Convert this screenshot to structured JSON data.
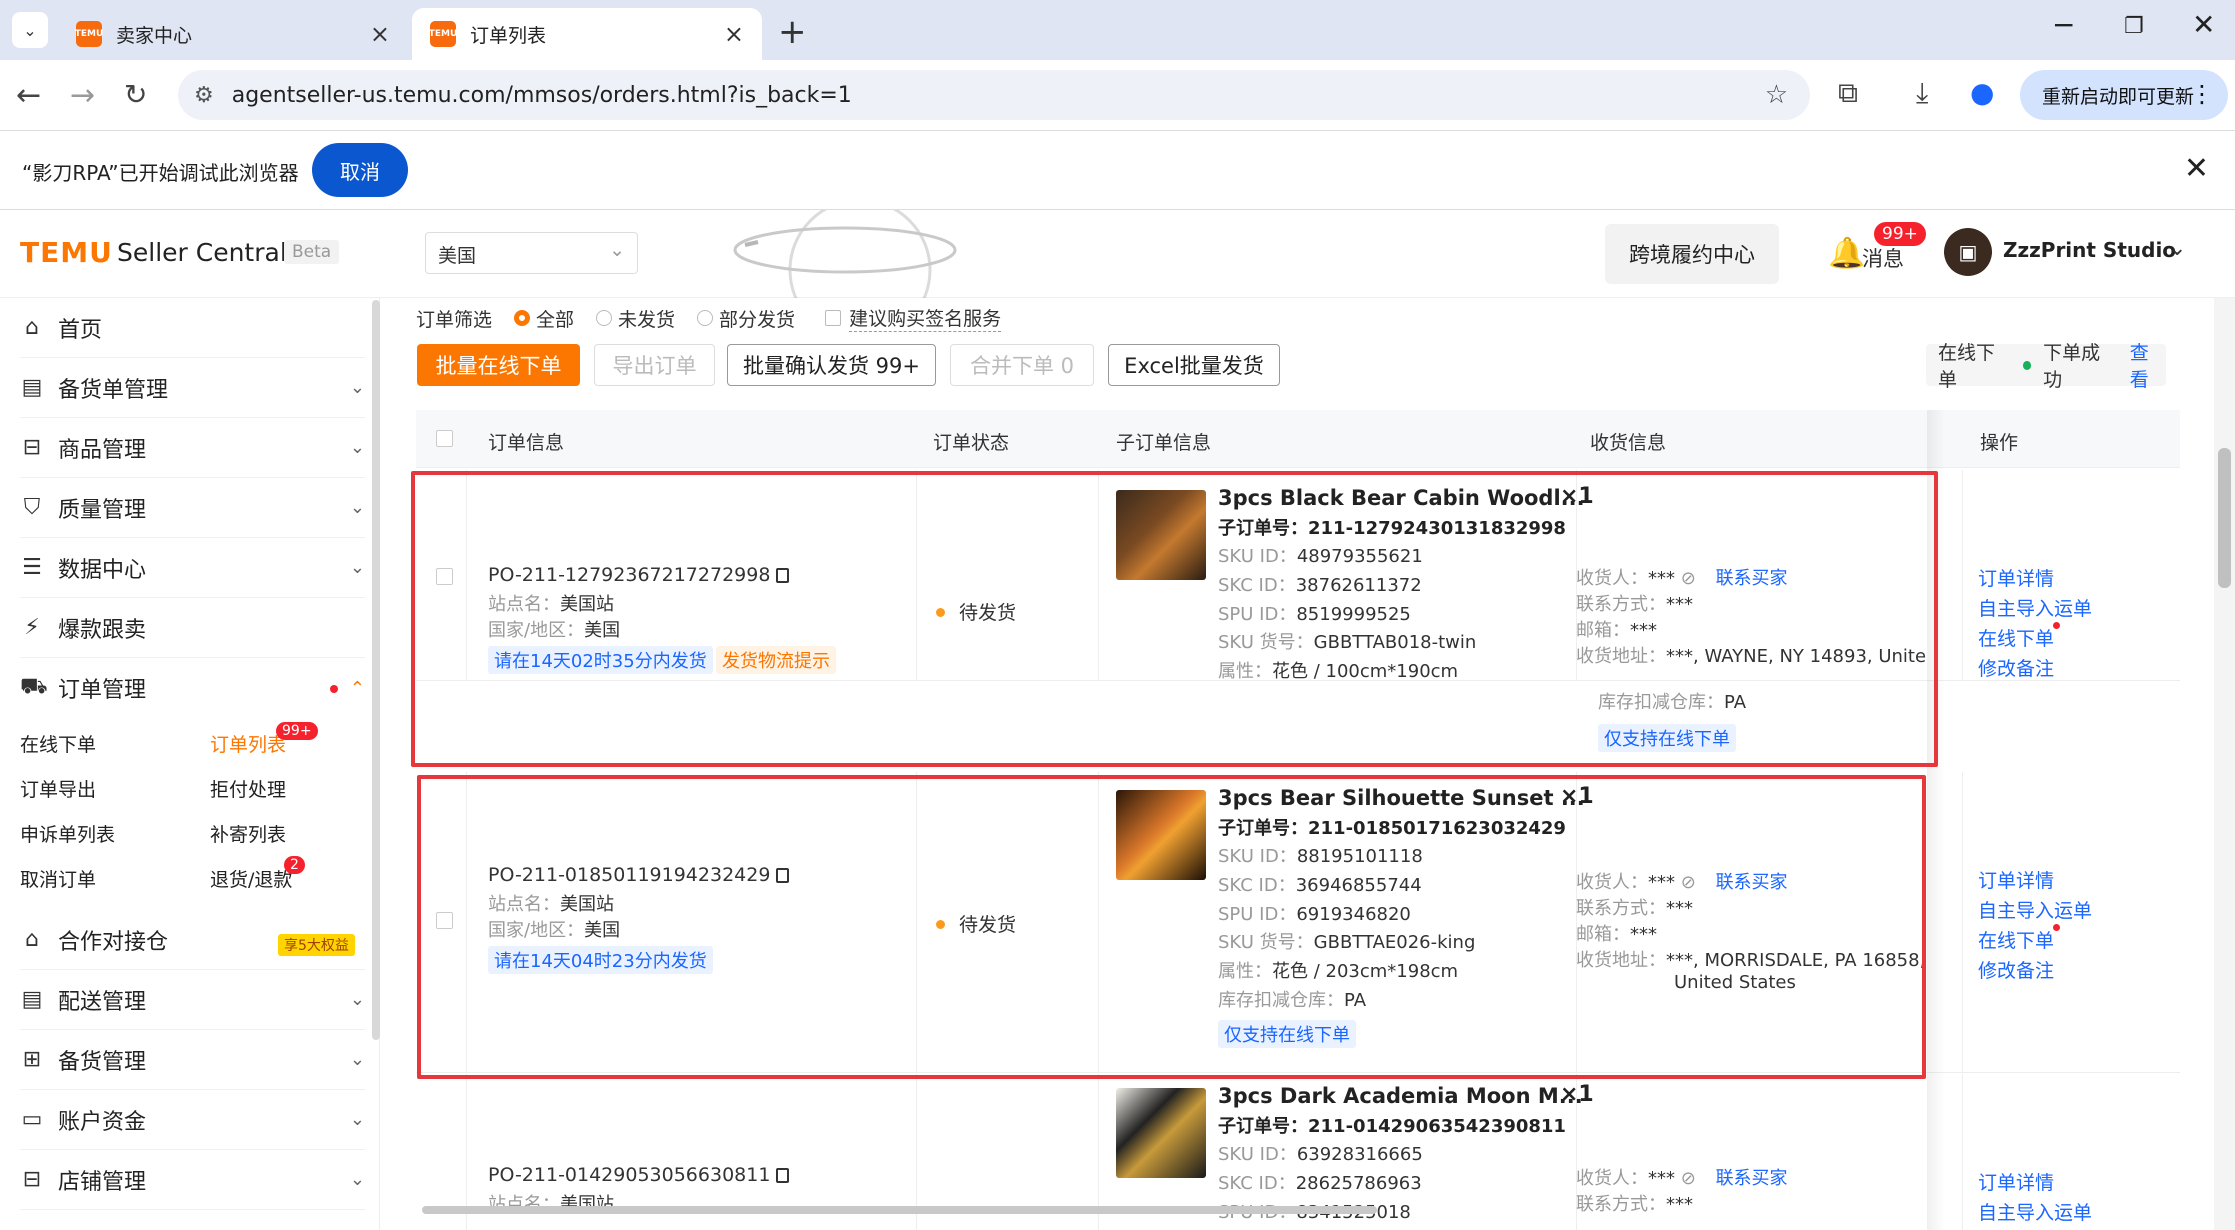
{
  "browser": {
    "tabs": [
      {
        "label": "卖家中心",
        "favicon": "TEMU"
      },
      {
        "label": "订单列表",
        "favicon": "TEMU"
      }
    ],
    "url": "agentseller-us.temu.com/mmsos/orders.html?is_back=1",
    "update_button": "重新启动即可更新",
    "rpa_message": "“影刀RPA”已开始调试此浏览器",
    "rpa_cancel": "取消"
  },
  "header": {
    "logo": "TEMU",
    "brand": "Seller Central",
    "beta": "Beta",
    "region": "美国",
    "cross_border": "跨境履约中心",
    "messages_label": "消息",
    "messages_badge": "99+",
    "shop_name": "ZzzPrint Studio"
  },
  "sidebar": {
    "items": [
      {
        "label": "首页",
        "icon": "home-icon"
      },
      {
        "label": "备货单管理",
        "icon": "clipboard-icon"
      },
      {
        "label": "商品管理",
        "icon": "box-icon"
      },
      {
        "label": "质量管理",
        "icon": "shield-check-icon"
      },
      {
        "label": "数据中心",
        "icon": "data-icon"
      },
      {
        "label": "爆款跟卖",
        "icon": "trend-icon"
      },
      {
        "label": "订单管理",
        "icon": "cart-icon"
      }
    ],
    "sub": {
      "online_order": "在线下单",
      "order_list": "订单列表",
      "order_list_badge": "99+",
      "order_export": "订单导出",
      "reject": "拒付处理",
      "appeal": "申诉单列表",
      "resend": "补寄列表",
      "cancel": "取消订单",
      "refund": "退货/退款",
      "refund_badge": "2"
    },
    "items2": [
      {
        "label": "合作对接仓",
        "icon": "warehouse-icon",
        "promo": "享5大权益"
      },
      {
        "label": "配送管理",
        "icon": "delivery-icon"
      },
      {
        "label": "备货管理",
        "icon": "stock-icon"
      },
      {
        "label": "账户资金",
        "icon": "wallet-icon"
      },
      {
        "label": "店铺管理",
        "icon": "store-icon"
      }
    ]
  },
  "filter": {
    "label": "订单筛选",
    "options": [
      "全部",
      "未发货",
      "部分发货"
    ],
    "selected": "全部",
    "sign_service": "建议购买签名服务"
  },
  "actions": {
    "batch_online": "批量在线下单",
    "export": "导出订单",
    "batch_confirm": "批量确认发货 99+",
    "merge": "合并下单  0",
    "excel": "Excel批量发货"
  },
  "status": {
    "online": "在线下单",
    "success": "下单成功",
    "view": "查看"
  },
  "table": {
    "headers": [
      "订单信息",
      "订单状态",
      "子订单信息",
      "收货信息",
      "操作"
    ],
    "labels": {
      "site": "站点名：",
      "region": "国家/地区：",
      "sub_order": "子订单号：",
      "sku_id": "SKU ID：",
      "skc_id": "SKC ID：",
      "spu_id": "SPU ID：",
      "sku_code": "SKU 货号：",
      "attr": "属性：",
      "warehouse": "库存扣减仓库：",
      "receiver": "收货人：",
      "contact": "联系方式：",
      "email": "邮箱：",
      "address": "收货地址：",
      "contact_buyer": "联系买家",
      "only_online": "仅支持在线下单"
    },
    "ops": [
      "订单详情",
      "自主导入运单",
      "在线下单",
      "修改备注"
    ],
    "rows": [
      {
        "po": "PO-211-12792367217272998",
        "site": "美国站",
        "region": "美国",
        "deadline": "请在14天02时35分内发货",
        "logistics_tip": "发货物流提示",
        "status": "待发货",
        "title": "3pcs Black Bear Cabin Woodl...",
        "qty": "×1",
        "sub_order": "211-12792430131832998",
        "sku_id": "48979355621",
        "skc_id": "38762611372",
        "spu_id": "8519999525",
        "sku_code": "GBBTTAB018-twin",
        "attr": "花色 / 100cm*190cm",
        "warehouse": "PA",
        "receiver": "***",
        "contact": "***",
        "email": "***",
        "address": "***, WAYNE, NY 14893, Unite",
        "address2": ""
      },
      {
        "po": "PO-211-01850119194232429",
        "site": "美国站",
        "region": "美国",
        "deadline": "请在14天04时23分内发货",
        "logistics_tip": "",
        "status": "待发货",
        "title": "3pcs Bear Silhouette Sunset ...",
        "qty": "×1",
        "sub_order": "211-01850171623032429",
        "sku_id": "88195101118",
        "skc_id": "36946855744",
        "spu_id": "6919346820",
        "sku_code": "GBBTTAE026-king",
        "attr": "花色 / 203cm*198cm",
        "warehouse": "PA",
        "receiver": "***",
        "contact": "***",
        "email": "***",
        "address": "***, MORRISDALE, PA 16858,",
        "address2": "United States"
      },
      {
        "po": "PO-211-01429053056630811",
        "site": "美国站",
        "status": "",
        "title": "3pcs Dark Academia Moon M...",
        "qty": "×1",
        "sub_order": "211-01429063542390811",
        "sku_id": "63928316665",
        "skc_id": "28625786963",
        "spu_id": "8341525018",
        "receiver": "***",
        "contact": "***"
      }
    ]
  },
  "colors": {
    "accent": "#fb7701",
    "link": "#1a66ff",
    "highlight": "#e5373c"
  }
}
